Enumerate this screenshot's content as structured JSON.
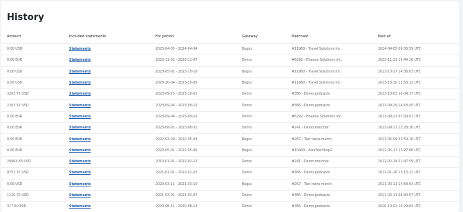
{
  "page": {
    "title": "History"
  },
  "table": {
    "headers": [
      "Amount",
      "Included statements",
      "For period",
      "Gateway",
      "Merchant",
      "Paid at:"
    ],
    "rows": [
      {
        "amount": "0.00 USD",
        "statements": "Statements",
        "period": "2023-04-05 - 2024-04-04",
        "gateway": "Bogus",
        "merchant": "#11960 - Travel Solutions Inc.",
        "paid_at": "2024-04-05 09:36:59 UTC"
      },
      {
        "amount": "0.00 EUR",
        "statements": "Statements",
        "period": "2023-11-01 - 2023-11-07",
        "gateway": "Demo",
        "merchant": "#6292 - Finance Solutions Inc.",
        "paid_at": "2023-11-21 14:44:16 UTC"
      },
      {
        "amount": "0.00 USD",
        "statements": "Statements",
        "period": "2023-05-01 - 2023-10-16",
        "gateway": "Bogus",
        "merchant": "#11960 - Travel Solutions Inc.",
        "paid_at": "2023-10-17 14:36:03 UTC"
      },
      {
        "amount": "0.00 USD",
        "statements": "Statements",
        "period": "2023-10-04 - 2023-10-09",
        "gateway": "Bogus",
        "merchant": "#11960 - Travel Solutions Inc.",
        "paid_at": "2023-10-10 12:50:12 UTC"
      },
      {
        "amount": "3263.75 USD",
        "statements": "Statements",
        "period": "2023-09-25 - 2023-10-01",
        "gateway": "Demo",
        "merchant": "#366 - Demo podcasts",
        "paid_at": "2023-10-03 20:04:37 UTC"
      },
      {
        "amount": "2263.52 USD",
        "statements": "Statements",
        "period": "2023-09-04 - 2023-09-10",
        "gateway": "Demo",
        "merchant": "#366 - Demo podcasts",
        "paid_at": "2023-09-29 14:18:45 UTC"
      },
      {
        "amount": "0.00 EUR",
        "statements": "Statements",
        "period": "2023-09-04 - 2023-09-10",
        "gateway": "Demo",
        "merchant": "#6292 - Finance Solutions Inc.",
        "paid_at": "2023-09-27 07:09:01 UTC"
      },
      {
        "amount": "0.00 EUR",
        "statements": "Statements",
        "period": "2023-08-01 - 2023-08-31",
        "gateway": "Demo",
        "merchant": "#241 - Demo merchat",
        "paid_at": "2023-09-11 12:28:38 UTC"
      },
      {
        "amount": "0.00 EUR",
        "statements": "Statements",
        "period": "2022-03-09 - 2022-05-04",
        "gateway": "Bogus",
        "merchant": "#267 - Test trans merch",
        "paid_at": "2023-05-09 23:59:16 UTC"
      },
      {
        "amount": "0.00 EUR",
        "statements": "Statements",
        "period": "2022-05-01 - 2022-05-06",
        "gateway": "Bogus",
        "merchant": "#10443 - AlexTestShop2",
        "paid_at": "2022-05-17 13:27:06 UTC"
      },
      {
        "amount": "29904.83 USD",
        "statements": "Statements",
        "period": "2013-01-01 - 2022-02-13",
        "gateway": "Demo",
        "merchant": "#241 - Demo merchat",
        "paid_at": "2022-02-14 21:47:59 UTC"
      },
      {
        "amount": "9751.37 USD",
        "statements": "Statements",
        "period": "2021-01-01 - 2022-01-25",
        "gateway": "Demo",
        "merchant": "#366 - Demo podcasts",
        "paid_at": "2022-01-26 15:13:22 UTC"
      },
      {
        "amount": "0.00 USD",
        "statements": "Statements",
        "period": "2020-03-11 - 2021-03-10",
        "gateway": "Bogus",
        "merchant": "#267 - Test trans merch",
        "paid_at": "2021-03-11 14:58:03 UTC"
      },
      {
        "amount": "1126.72 USD",
        "statements": "Statements",
        "period": "2021-03-01 - 2021-03-07",
        "gateway": "Demo",
        "merchant": "#366 - Demo podcasts",
        "paid_at": "2021-03-11 06:44:57 UTC"
      },
      {
        "amount": "317.50 EUR",
        "statements": "Statements",
        "period": "2020-08-11 - 2020-08-14",
        "gateway": "Demo",
        "merchant": "#366 - Demo podcasts",
        "paid_at": "2020-10-02 10:29:04 UTC"
      }
    ]
  }
}
